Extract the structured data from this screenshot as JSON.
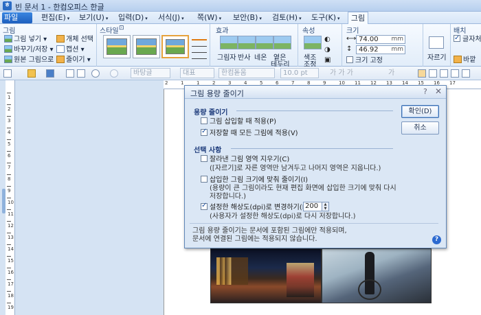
{
  "window": {
    "title": "빈 문서 1 - 한컴오피스 한글"
  },
  "menu": {
    "file": "파일(F)",
    "items": [
      "편집(E)",
      "보기(U)",
      "입력(D)",
      "서식(J)",
      "쪽(W)",
      "보안(B)",
      "검토(H)",
      "도구(K)"
    ],
    "active_tab": "그림"
  },
  "ribbon": {
    "group_picture": {
      "title": "그림",
      "insert": "그림 넣기",
      "change_save": "바꾸기/저장",
      "original": "원본 그림으로",
      "select_object": "개체 선택",
      "caption": "캡션",
      "reduce": "줄이기"
    },
    "group_style": {
      "title": "스타일"
    },
    "group_effect": {
      "title": "효과",
      "shadow": "그림자",
      "reflect": "반사",
      "neon": "네온",
      "soft_edge_1": "옅은",
      "soft_edge_2": "테두리"
    },
    "group_property": {
      "title": "속성",
      "color_adjust_1": "색조",
      "color_adjust_2": "조정"
    },
    "group_size": {
      "title": "크기",
      "width": "74.00",
      "height": "46.92",
      "unit": "mm",
      "fix_size": "크기 고정",
      "crop": "자르기"
    },
    "group_layout": {
      "title": "배치",
      "text_wrap": "글자처",
      "behind": "바깥"
    }
  },
  "toolbar": {
    "style_combo": "바탕글",
    "font_kind": "대표",
    "font_name": "한컴돋움",
    "font_size": "10.0",
    "font_unit": "pt",
    "format_chars": "가 가 가",
    "color_char": "가"
  },
  "ruler": {
    "vertical": [
      "1",
      "2",
      "3",
      "4",
      "5",
      "6",
      "7",
      "8",
      "9",
      "10",
      "11",
      "12",
      "13",
      "14",
      "15",
      "16",
      "17",
      "18",
      "19"
    ],
    "horizontal": [
      "2",
      "1",
      "1",
      "2",
      "3",
      "4",
      "5",
      "6",
      "7",
      "8",
      "9",
      "10",
      "11",
      "12",
      "13",
      "14",
      "15",
      "16",
      "17"
    ]
  },
  "dialog": {
    "title": "그림 용량 줄이기",
    "help_icon": "?",
    "close_icon": "✕",
    "section_reduce": "용량 줄이기",
    "opt_on_insert": {
      "label": "그림 삽입할 때 적용(P)",
      "checked": false
    },
    "opt_on_save": {
      "label": "저장할 때 모든 그림에 적용(V)",
      "checked": true
    },
    "section_options": "선택 사항",
    "opt_delete_cropped": {
      "label": "잘라낸 그림 영역 지우기(C)",
      "checked": false
    },
    "note_delete_cropped": "([자르기]로 자른 영역만 남겨두고 나머지 영역은 지웁니다.)",
    "opt_fit_size": {
      "label": "삽입한 그림 크기에 맞춰 줄이기(I)",
      "checked": false
    },
    "note_fit_size_1": "(용량이 큰 그림이라도 현재 편집 화면에 삽입한 크기에 맞춰 다시",
    "note_fit_size_2": "저장합니다.)",
    "opt_dpi": {
      "label": "설정한 해상도(dpi)로 변경하기(R):",
      "checked": true
    },
    "dpi_value": "200",
    "note_dpi": "(사용자가 설정한 해상도(dpi)로 다시 저장합니다.)",
    "footer_1": "그림 용량 줄이기는 문서에 포함된 그림에만 적용되며,",
    "footer_2": "문서에 연결된 그림에는 적용되지 않습니다.",
    "ok_button": "확인(D)",
    "cancel_button": "취소"
  }
}
